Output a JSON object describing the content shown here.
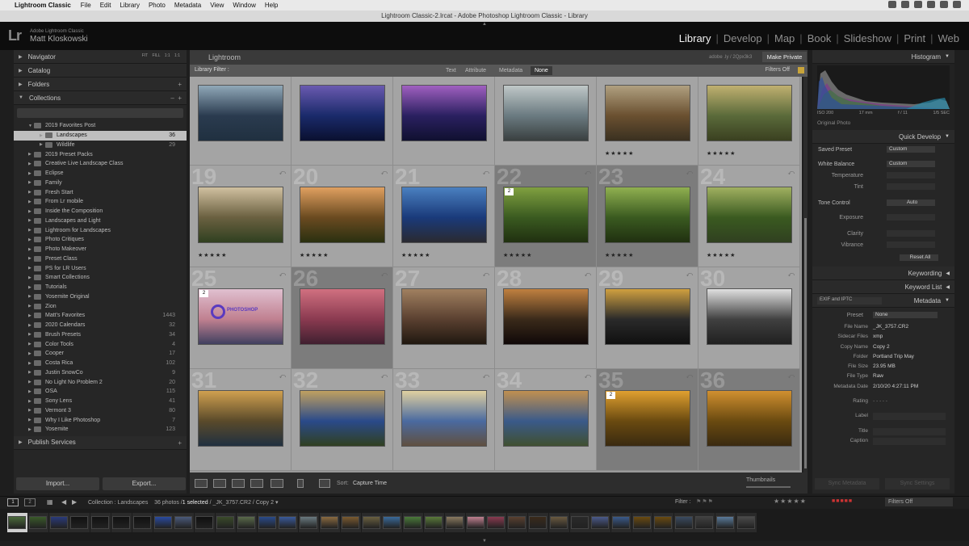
{
  "menubar": {
    "app": "Lightroom Classic",
    "items": [
      "File",
      "Edit",
      "Library",
      "Photo",
      "Metadata",
      "View",
      "Window",
      "Help"
    ]
  },
  "window_title": "Lightroom Classic-2.lrcat - Adobe Photoshop Lightroom Classic - Library",
  "identity": {
    "sub": "Adobe Lightroom Classic",
    "name": "Matt Kloskowski",
    "logo": "Lr"
  },
  "modules": [
    "Library",
    "Develop",
    "Map",
    "Book",
    "Slideshow",
    "Print",
    "Web"
  ],
  "left": {
    "navigator": "Navigator",
    "navigator_extra": "FIT FILL 1:1 1:1",
    "catalog": "Catalog",
    "folders": "Folders",
    "collections": "Collections",
    "collection_items": [
      {
        "name": "2019 Favorites Post",
        "count": "",
        "indent": 1
      },
      {
        "name": "Landscapes",
        "count": "36",
        "indent": 2,
        "selected": true
      },
      {
        "name": "Wildlife",
        "count": "29",
        "indent": 2
      },
      {
        "name": "2019 Preset Packs",
        "count": "",
        "indent": 1
      },
      {
        "name": "Creative Live Landscape Class",
        "count": "",
        "indent": 1
      },
      {
        "name": "Eclipse",
        "count": "",
        "indent": 1
      },
      {
        "name": "Family",
        "count": "",
        "indent": 1
      },
      {
        "name": "Fresh Start",
        "count": "",
        "indent": 1
      },
      {
        "name": "From Lr mobile",
        "count": "",
        "indent": 1
      },
      {
        "name": "Inside the Composition",
        "count": "",
        "indent": 1
      },
      {
        "name": "Landscapes and Light",
        "count": "",
        "indent": 1
      },
      {
        "name": "Lightroom for Landscapes",
        "count": "",
        "indent": 1
      },
      {
        "name": "Photo Critiques",
        "count": "",
        "indent": 1
      },
      {
        "name": "Photo Makeover",
        "count": "",
        "indent": 1
      },
      {
        "name": "Preset Class",
        "count": "",
        "indent": 1
      },
      {
        "name": "PS for LR Users",
        "count": "",
        "indent": 1
      },
      {
        "name": "Smart Collections",
        "count": "",
        "indent": 1
      },
      {
        "name": "Tutorials",
        "count": "",
        "indent": 1
      },
      {
        "name": "Yosemite Original",
        "count": "",
        "indent": 1
      },
      {
        "name": "Zion",
        "count": "",
        "indent": 1
      },
      {
        "name": "Matt's Favorites",
        "count": "1443",
        "indent": 1
      },
      {
        "name": "2020 Calendars",
        "count": "32",
        "indent": 1
      },
      {
        "name": "Brush Presets",
        "count": "34",
        "indent": 1
      },
      {
        "name": "Color Tools",
        "count": "4",
        "indent": 1
      },
      {
        "name": "Cooper",
        "count": "17",
        "indent": 1
      },
      {
        "name": "Costa Rica",
        "count": "102",
        "indent": 1
      },
      {
        "name": "Justin SnowCo",
        "count": "9",
        "indent": 1
      },
      {
        "name": "No Light No Problem 2",
        "count": "20",
        "indent": 1
      },
      {
        "name": "OSA",
        "count": "115",
        "indent": 1
      },
      {
        "name": "Sony Lens",
        "count": "41",
        "indent": 1
      },
      {
        "name": "Vermont 3",
        "count": "80",
        "indent": 1
      },
      {
        "name": "Why I Like Photoshop",
        "count": "7",
        "indent": 1
      },
      {
        "name": "Yosemite",
        "count": "123",
        "indent": 1
      }
    ],
    "publish": "Publish Services",
    "import": "Import...",
    "export": "Export..."
  },
  "center": {
    "title": "Lightroom",
    "sub": "adobe .ly / 2Qpx3k3",
    "make_private": "Make Private",
    "filter_label": "Library Filter :",
    "filter_tabs": [
      "Text",
      "Attribute",
      "Metadata",
      "None"
    ],
    "filters_off": "Filters Off",
    "sort_label": "Sort:",
    "sort_value": "Capture Time",
    "thumbnails": "Thumbnails",
    "cells": [
      {
        "num": "",
        "stars": ""
      },
      {
        "num": "",
        "stars": ""
      },
      {
        "num": "",
        "stars": ""
      },
      {
        "num": "",
        "stars": ""
      },
      {
        "num": "",
        "stars": "★★★★★"
      },
      {
        "num": "",
        "stars": "★★★★★"
      },
      {
        "num": "19",
        "stars": "★★★★★"
      },
      {
        "num": "20",
        "stars": "★★★★★"
      },
      {
        "num": "21",
        "stars": "★★★★★"
      },
      {
        "num": "22",
        "stars": "★★★★★",
        "badge": "2"
      },
      {
        "num": "23",
        "stars": "★★★★★"
      },
      {
        "num": "24",
        "stars": "★★★★★"
      },
      {
        "num": "25",
        "stars": "",
        "badge": "2"
      },
      {
        "num": "26",
        "stars": ""
      },
      {
        "num": "27",
        "stars": ""
      },
      {
        "num": "28",
        "stars": ""
      },
      {
        "num": "29",
        "stars": ""
      },
      {
        "num": "30",
        "stars": ""
      },
      {
        "num": "31",
        "stars": ""
      },
      {
        "num": "32",
        "stars": ""
      },
      {
        "num": "33",
        "stars": ""
      },
      {
        "num": "34",
        "stars": ""
      },
      {
        "num": "35",
        "stars": "",
        "badge": "2"
      },
      {
        "num": "36",
        "stars": ""
      }
    ],
    "ps_logo_text": "PHOTOSHOP"
  },
  "right": {
    "histogram": "Histogram",
    "histo_info": [
      "ISO 200",
      "17 mm",
      "f / 11",
      "1/5 SEC"
    ],
    "original_photo": "Original Photo",
    "quick_develop": "Quick Develop",
    "saved_preset": "Saved Preset",
    "saved_preset_val": "Custom",
    "white_balance": "White Balance",
    "white_balance_val": "Custom",
    "temperature": "Temperature",
    "tint": "Tint",
    "tone_control": "Tone Control",
    "auto": "Auto",
    "exposure": "Exposure",
    "clarity": "Clarity",
    "vibrance": "Vibrance",
    "reset_all": "Reset All",
    "keywording": "Keywording",
    "keyword_list": "Keyword List",
    "metadata": "Metadata",
    "metadata_set": "EXIF and IPTC",
    "preset_label": "Preset",
    "preset_val": "None",
    "meta_rows": [
      {
        "label": "File Name",
        "value": "_JK_3757.CR2"
      },
      {
        "label": "Sidecar Files",
        "value": "xmp"
      },
      {
        "label": "Copy Name",
        "value": "Copy 2"
      },
      {
        "label": "Folder",
        "value": "Portland Trip May"
      },
      {
        "label": "File Size",
        "value": "23.95 MB"
      },
      {
        "label": "File Type",
        "value": "Raw"
      },
      {
        "label": "Metadata Date",
        "value": "2/10/20 4:27:11 PM"
      }
    ],
    "rating_label": "Rating",
    "rating_val": "· · · · ·",
    "label_label": "Label",
    "title_label": "Title",
    "caption_label": "Caption",
    "sync_metadata": "Sync Metadata",
    "sync_settings": "Sync Settings"
  },
  "filmstrip": {
    "pages": [
      "1",
      "2"
    ],
    "info_collection": "Collection : Landscapes",
    "info_count": "36 photos /",
    "info_selected": "1 selected",
    "info_file": "/ _JK_3757.CR2 / Copy 2 ▾",
    "filter": "Filter :",
    "filters_off": "Filters Off"
  },
  "colors": {
    "accent_selected": "#bfbfbf",
    "filter_lock": "#c8a43a"
  }
}
